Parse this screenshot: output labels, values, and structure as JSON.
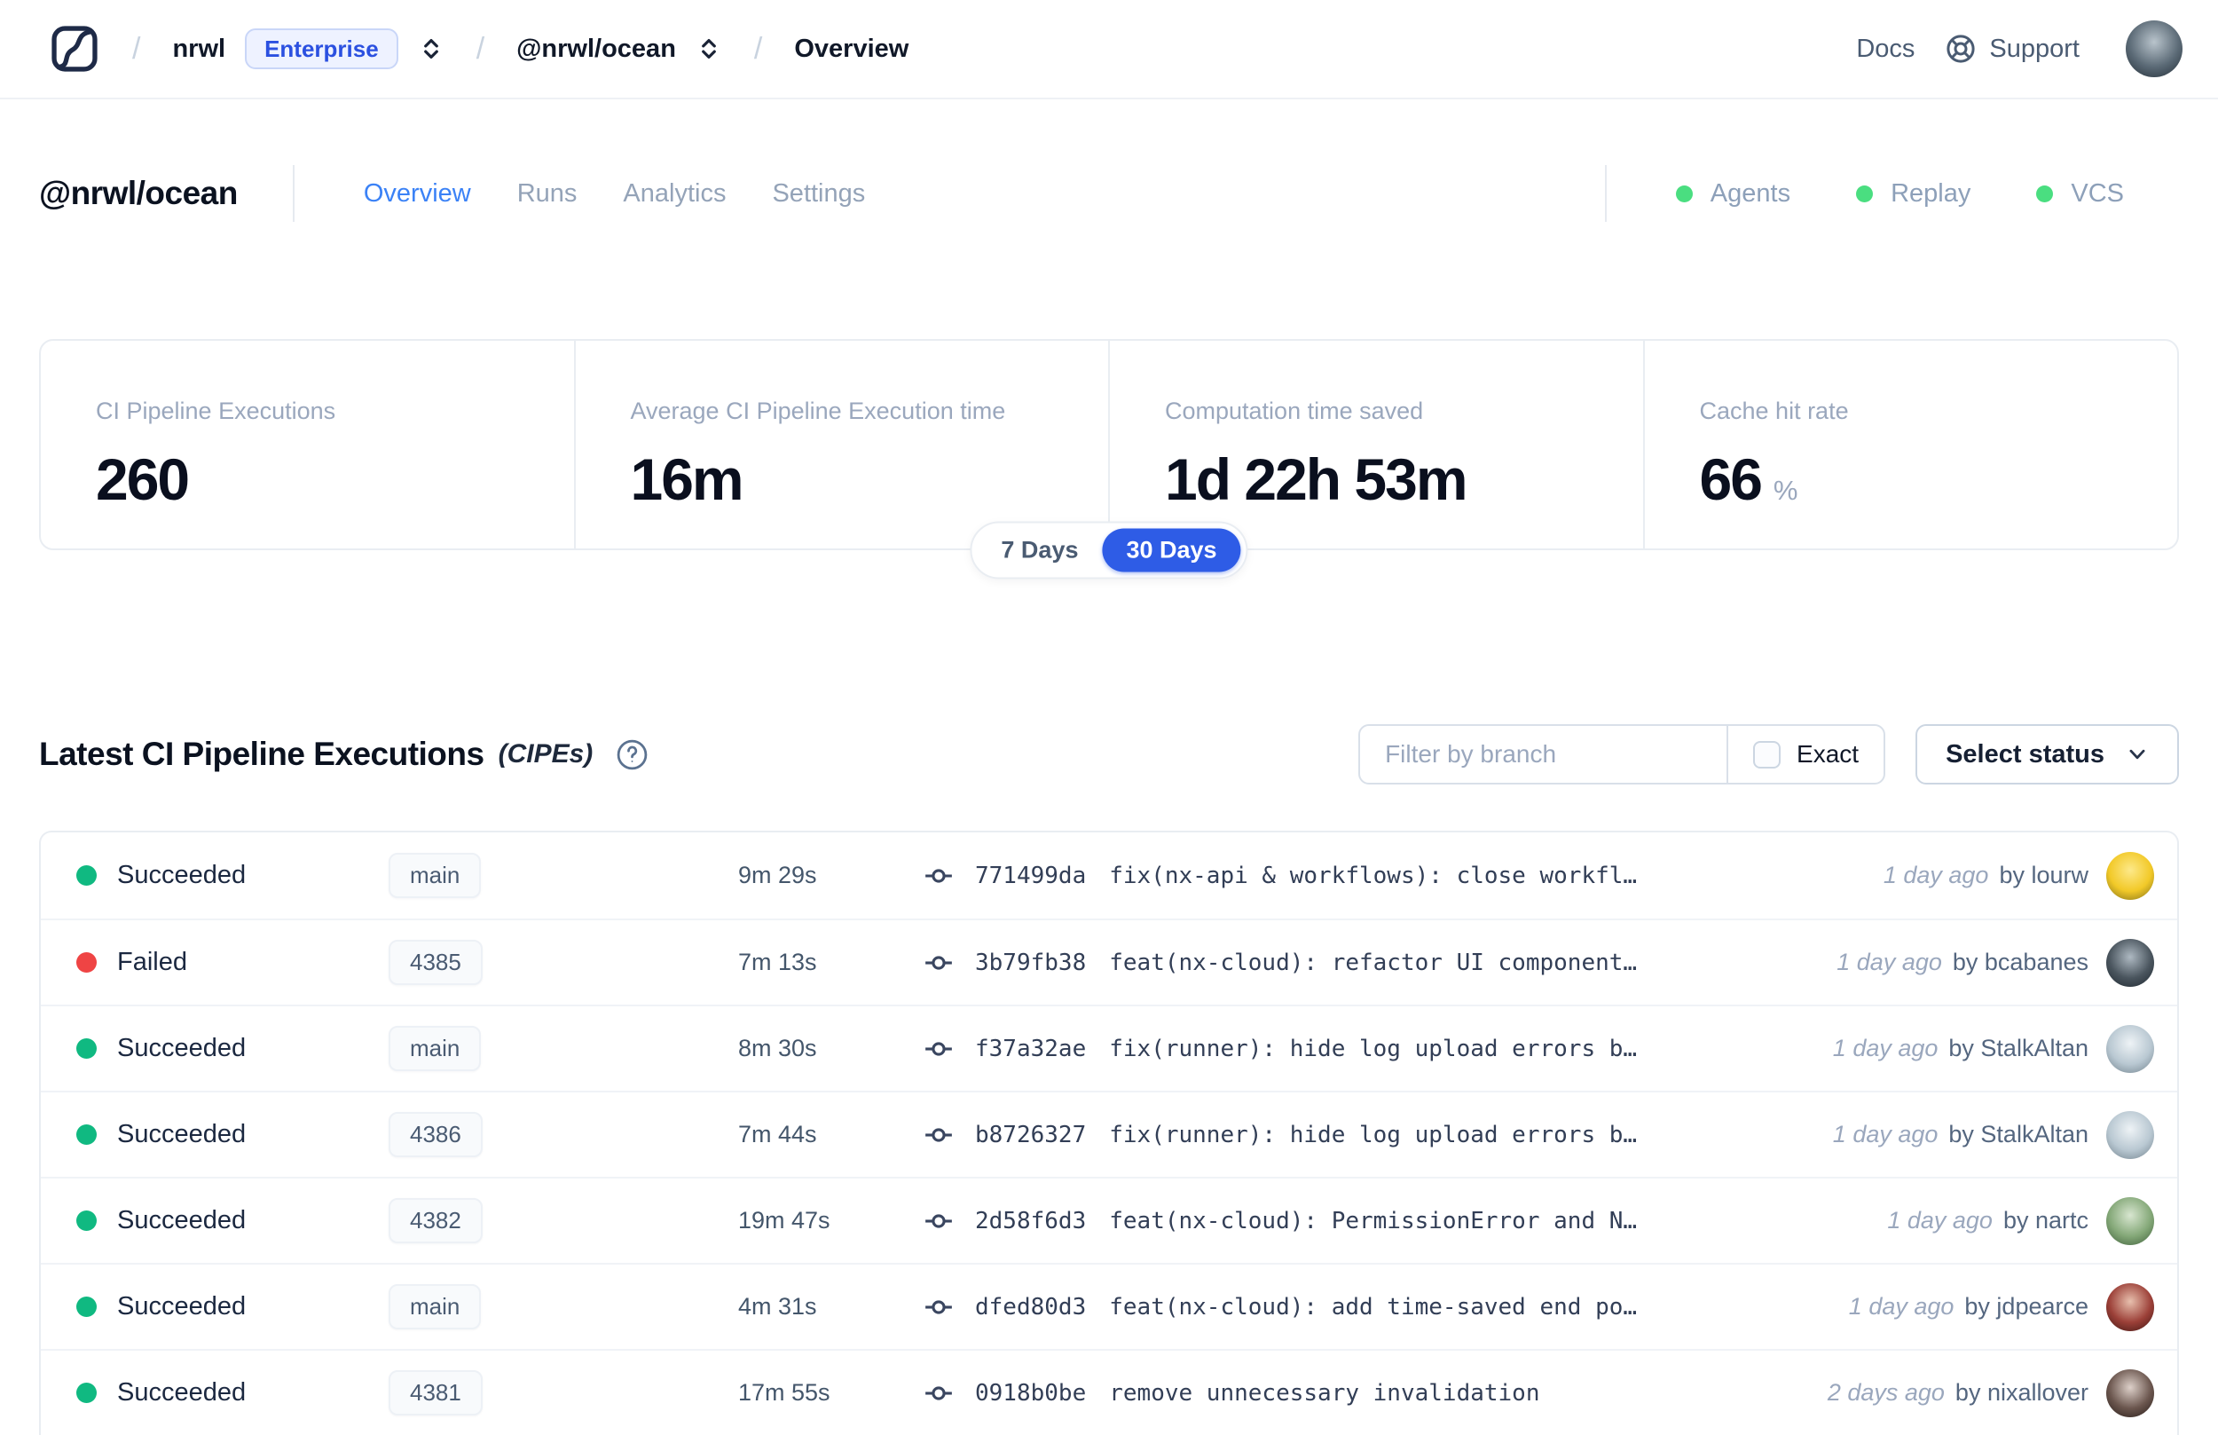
{
  "colors": {
    "enterprise_blue": "#2b50e0",
    "tab_active": "#3b82f6",
    "pill_active": "#2e5ce6",
    "success": "#10b981",
    "failed": "#ef4444",
    "online": "#4ade80"
  },
  "topbar": {
    "breadcrumb": {
      "separator": "/",
      "org": "nrwl",
      "org_badge": "Enterprise",
      "workspace": "@nrwl/ocean",
      "page": "Overview"
    },
    "links": {
      "docs": "Docs",
      "support": "Support"
    },
    "avatar_colors": [
      "#b9c4cc",
      "#5b6a76",
      "#222d36"
    ]
  },
  "workspace_header": {
    "title": "@nrwl/ocean",
    "tabs": [
      {
        "label": "Overview",
        "active": true
      },
      {
        "label": "Runs",
        "active": false
      },
      {
        "label": "Analytics",
        "active": false
      },
      {
        "label": "Settings",
        "active": false
      }
    ],
    "statuses": [
      {
        "label": "Agents"
      },
      {
        "label": "Replay"
      },
      {
        "label": "VCS"
      }
    ]
  },
  "stats": {
    "cards": [
      {
        "label": "CI Pipeline Executions",
        "value": "260",
        "suffix": ""
      },
      {
        "label": "Average CI Pipeline Execution time",
        "value": "16m",
        "suffix": ""
      },
      {
        "label": "Computation time saved",
        "value": "1d 22h 53m",
        "suffix": ""
      },
      {
        "label": "Cache hit rate",
        "value": "66",
        "suffix": "%"
      }
    ],
    "range_toggle": {
      "options": [
        "7 Days",
        "30 Days"
      ],
      "selected": "30 Days"
    }
  },
  "cipes": {
    "title": "Latest CI Pipeline Executions",
    "title_suffix": "(CIPEs)",
    "filter": {
      "placeholder": "Filter by branch",
      "exact_label": "Exact",
      "status_label": "Select status"
    },
    "rows": [
      {
        "status": "Succeeded",
        "branch": "main",
        "duration": "9m 29s",
        "commit": "771499da",
        "message": "fix(nx-api & workflows): close workfl…",
        "time": "1 day ago",
        "author": "by lourw",
        "avatar_colors": [
          "#fde98a",
          "#f2c928",
          "#7a6a1a"
        ]
      },
      {
        "status": "Failed",
        "branch": "4385",
        "duration": "7m 13s",
        "commit": "3b79fb38",
        "message": "feat(nx-cloud): refactor UI component…",
        "time": "1 day ago",
        "author": "by bcabanes",
        "avatar_colors": [
          "#aeb9c2",
          "#4a555e",
          "#1d262e"
        ]
      },
      {
        "status": "Succeeded",
        "branch": "main",
        "duration": "8m 30s",
        "commit": "f37a32ae",
        "message": "fix(runner): hide log upload errors b…",
        "time": "1 day ago",
        "author": "by StalkAltan",
        "avatar_colors": [
          "#eef3f6",
          "#b9c8d2",
          "#6e7f8a"
        ]
      },
      {
        "status": "Succeeded",
        "branch": "4386",
        "duration": "7m 44s",
        "commit": "b8726327",
        "message": "fix(runner): hide log upload errors b…",
        "time": "1 day ago",
        "author": "by StalkAltan",
        "avatar_colors": [
          "#eef3f6",
          "#b9c8d2",
          "#6e7f8a"
        ]
      },
      {
        "status": "Succeeded",
        "branch": "4382",
        "duration": "19m 47s",
        "commit": "2d58f6d3",
        "message": "feat(nx-cloud): PermissionError and N…",
        "time": "1 day ago",
        "author": "by nartc",
        "avatar_colors": [
          "#d8e6d0",
          "#84a878",
          "#3c5c38"
        ]
      },
      {
        "status": "Succeeded",
        "branch": "main",
        "duration": "4m 31s",
        "commit": "dfed80d3",
        "message": "feat(nx-cloud): add time-saved end po…",
        "time": "1 day ago",
        "author": "by jdpearce",
        "avatar_colors": [
          "#e8c0ae",
          "#9c4038",
          "#3a1512"
        ]
      },
      {
        "status": "Succeeded",
        "branch": "4381",
        "duration": "17m 55s",
        "commit": "0918b0be",
        "message": "remove unnecessary invalidation",
        "time": "2 days ago",
        "author": "by nixallover",
        "avatar_colors": [
          "#ddd0c9",
          "#6b564e",
          "#241a16"
        ]
      }
    ]
  }
}
